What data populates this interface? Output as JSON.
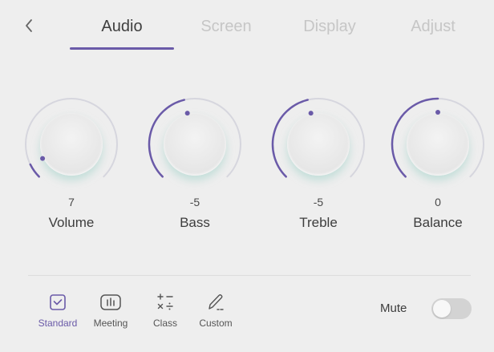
{
  "tabs": [
    {
      "label": "Audio",
      "active": true
    },
    {
      "label": "Screen",
      "active": false
    },
    {
      "label": "Display",
      "active": false
    },
    {
      "label": "Adjust",
      "active": false
    }
  ],
  "knobs": [
    {
      "value": "7",
      "label": "Volume",
      "level": 0.07
    },
    {
      "value": "-5",
      "label": "Bass",
      "level": 0.45
    },
    {
      "value": "-5",
      "label": "Treble",
      "level": 0.45
    },
    {
      "value": "0",
      "label": "Balance",
      "level": 0.5
    }
  ],
  "modes": [
    {
      "label": "Standard",
      "icon": "checkbox-square-icon",
      "active": true
    },
    {
      "label": "Meeting",
      "icon": "equalizer-bars-icon",
      "active": false
    },
    {
      "label": "Class",
      "icon": "math-operators-icon",
      "active": false
    },
    {
      "label": "Custom",
      "icon": "pencil-icon",
      "active": false
    }
  ],
  "mute": {
    "label": "Mute",
    "on": false
  },
  "colors": {
    "accent": "#6a5aa8",
    "track": "#d6d6de",
    "background": "#eeeeee"
  }
}
